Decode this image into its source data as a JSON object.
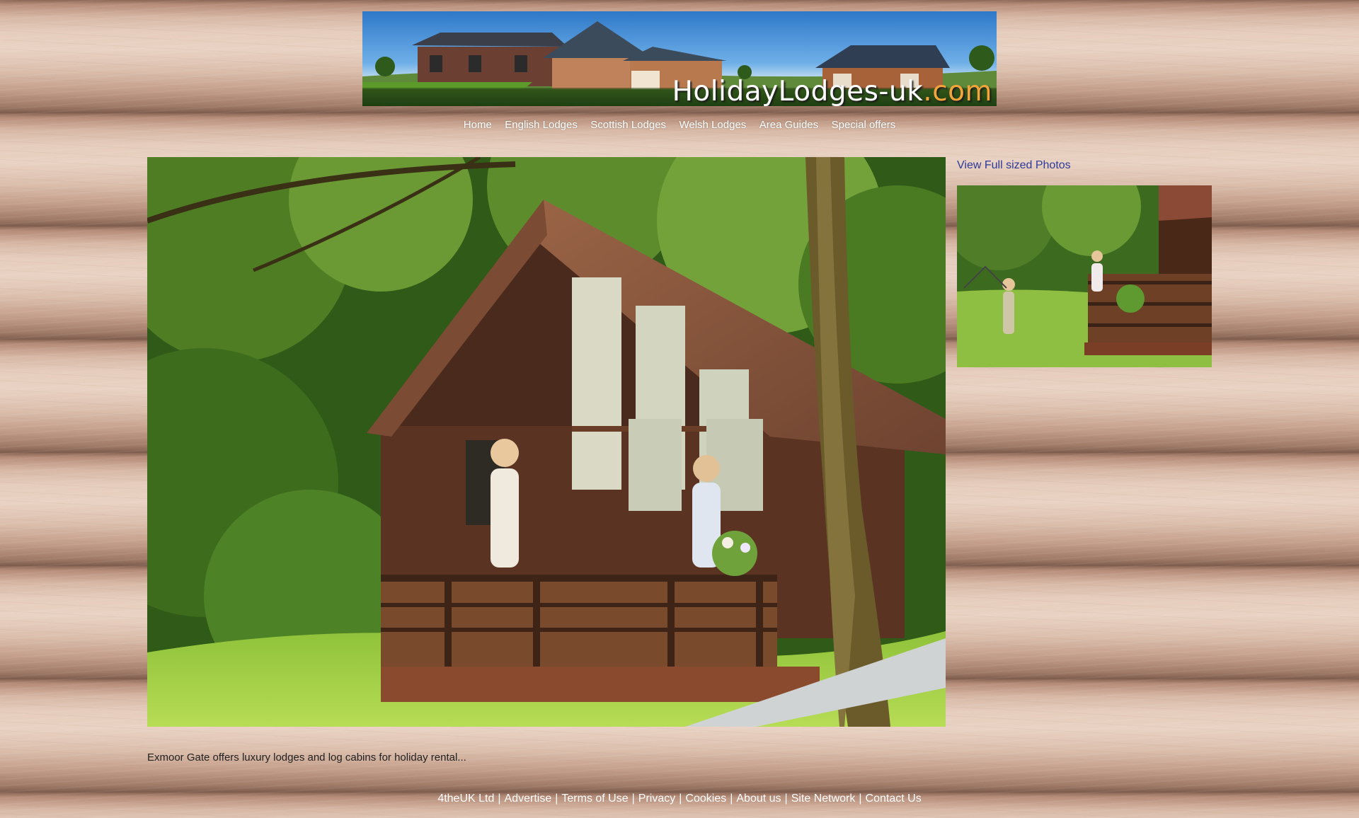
{
  "site": {
    "banner_title_main": "HolidayLodges-uk",
    "banner_title_suffix": ".com"
  },
  "nav": [
    {
      "label": "Home"
    },
    {
      "label": "English Lodges"
    },
    {
      "label": "Scottish Lodges"
    },
    {
      "label": "Welsh Lodges"
    },
    {
      "label": "Area Guides"
    },
    {
      "label": "Special offers"
    }
  ],
  "main": {
    "caption": "Exmoor Gate offers luxury lodges and log cabins for holiday rental...",
    "side_link": "View Full sized Photos"
  },
  "footer": [
    {
      "label": "4theUK Ltd"
    },
    {
      "label": "Advertise"
    },
    {
      "label": "Terms of Use"
    },
    {
      "label": "Privacy"
    },
    {
      "label": "Cookies"
    },
    {
      "label": "About us"
    },
    {
      "label": "Site Network"
    },
    {
      "label": "Contact Us"
    }
  ],
  "colors": {
    "link": "#2d3a9a",
    "banner_accent": "#f3a53a"
  }
}
